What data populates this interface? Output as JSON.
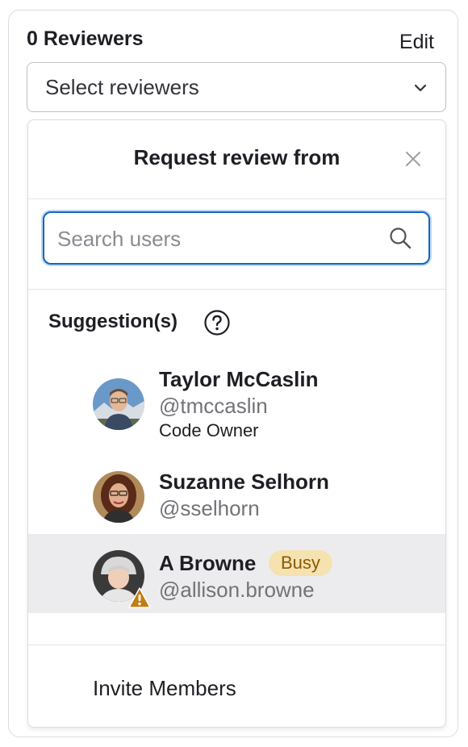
{
  "reviewers": {
    "title": "0 Reviewers",
    "edit_label": "Edit",
    "select_placeholder": "Select reviewers"
  },
  "dropdown": {
    "title": "Request review from",
    "search_placeholder": "Search users",
    "search_value": "",
    "section_label": "Suggestion(s)",
    "users": [
      {
        "name": "Taylor McCaslin",
        "handle": "@tmccaslin",
        "meta": "Code Owner"
      },
      {
        "name": "Suzanne Selhorn",
        "handle": "@sselhorn"
      },
      {
        "name": "A Browne",
        "handle": "@allison.browne",
        "badge": "Busy"
      }
    ],
    "footer_label": "Invite Members"
  },
  "colors": {
    "focus_border": "#1068bf",
    "busy_badge_bg": "#f5e2b0",
    "busy_badge_text": "#8a5a00",
    "hover_row_bg": "#ececef",
    "warning": "#c17d10"
  },
  "icons": [
    "chevron-down-icon",
    "close-icon",
    "search-icon",
    "help-icon",
    "warning-icon"
  ]
}
